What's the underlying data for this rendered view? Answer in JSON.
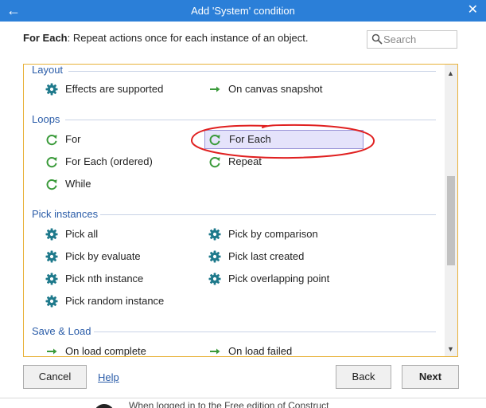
{
  "window": {
    "title": "Add 'System' condition"
  },
  "header": {
    "name": "For Each",
    "description": ": Repeat actions once for each instance of an object."
  },
  "search": {
    "placeholder": "Search",
    "value": ""
  },
  "categories": {
    "layout": {
      "title": "Layout",
      "items": [
        {
          "label": "Effects are supported",
          "icon": "gear-icon"
        },
        {
          "label": "On canvas snapshot",
          "icon": "arrow-right-icon"
        }
      ]
    },
    "loops": {
      "title": "Loops",
      "items": [
        {
          "label": "For",
          "icon": "loop-icon"
        },
        {
          "label": "For Each",
          "icon": "loop-icon",
          "selected": true
        },
        {
          "label": "For Each (ordered)",
          "icon": "loop-icon"
        },
        {
          "label": "Repeat",
          "icon": "loop-icon"
        },
        {
          "label": "While",
          "icon": "loop-icon"
        }
      ]
    },
    "pick": {
      "title": "Pick instances",
      "items": [
        {
          "label": "Pick all",
          "icon": "gear-icon"
        },
        {
          "label": "Pick by comparison",
          "icon": "gear-icon"
        },
        {
          "label": "Pick by evaluate",
          "icon": "gear-icon"
        },
        {
          "label": "Pick last created",
          "icon": "gear-icon"
        },
        {
          "label": "Pick nth instance",
          "icon": "gear-icon"
        },
        {
          "label": "Pick overlapping point",
          "icon": "gear-icon"
        },
        {
          "label": "Pick random instance",
          "icon": "gear-icon"
        }
      ]
    },
    "saveload": {
      "title": "Save & Load",
      "items": [
        {
          "label": "On load complete",
          "icon": "arrow-right-icon"
        },
        {
          "label": "On load failed",
          "icon": "arrow-right-icon"
        }
      ]
    }
  },
  "footer": {
    "cancel": "Cancel",
    "help": "Help",
    "back": "Back",
    "next": "Next"
  },
  "background_text": "When logged in to the Free edition of Construct",
  "colors": {
    "titlebar": "#2b7fd8",
    "gear": "#1f7a8c",
    "loop": "#3a9a3a",
    "arrow": "#3a9a3a",
    "selection": "#e5e3fb",
    "annotation": "#e02020"
  }
}
